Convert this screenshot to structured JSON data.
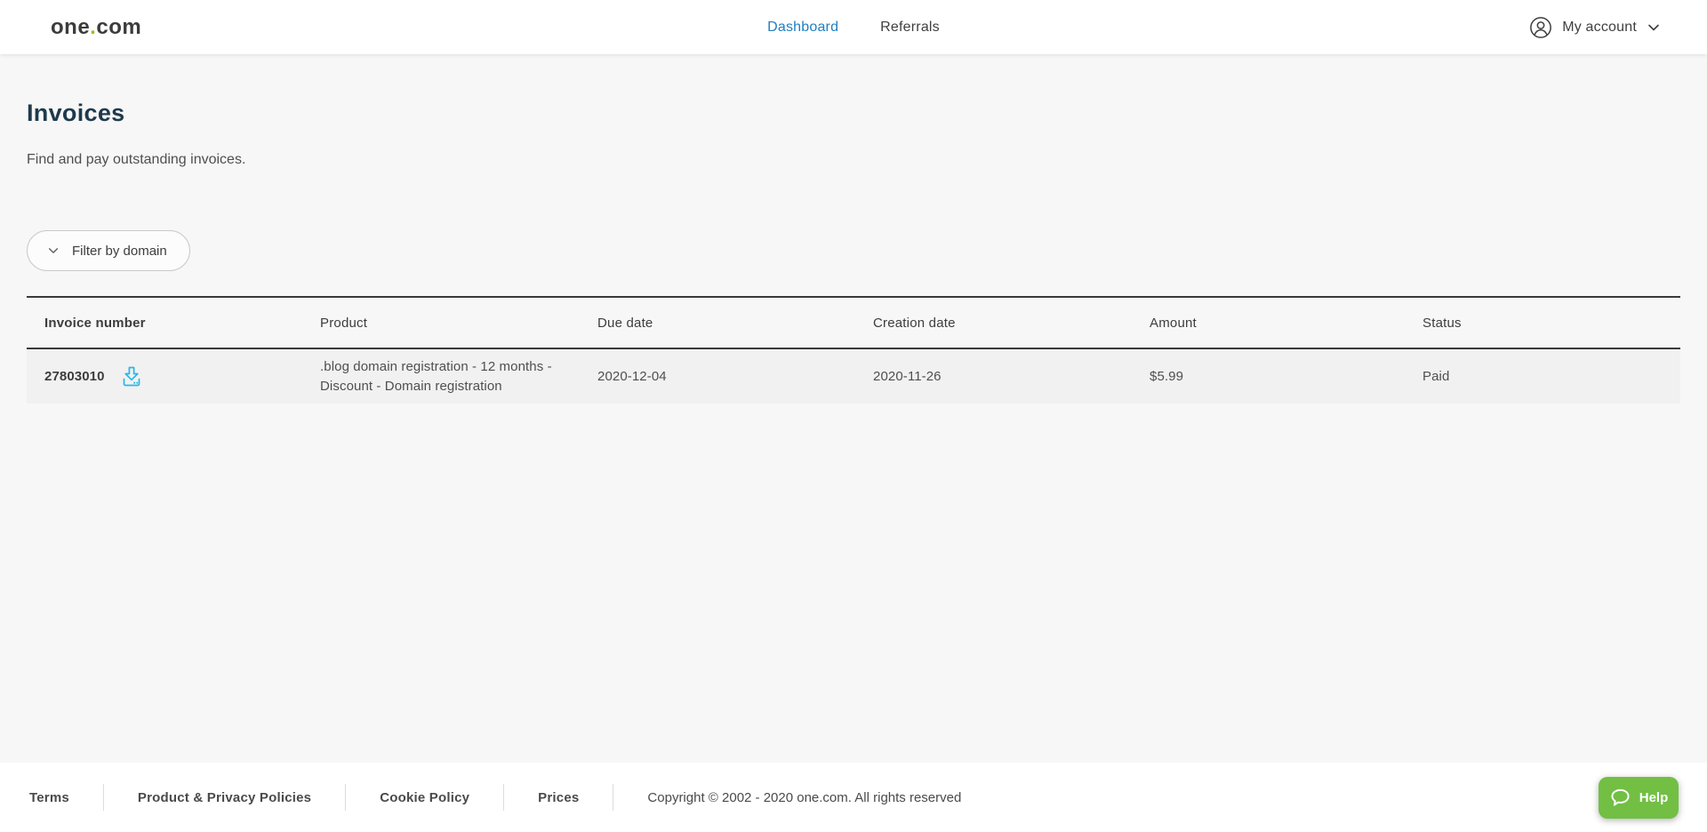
{
  "header": {
    "logo": {
      "part1": "one",
      "dot": ".",
      "part2": "com"
    },
    "nav": [
      {
        "label": "Dashboard",
        "active": true
      },
      {
        "label": "Referrals",
        "active": false
      }
    ],
    "account": {
      "label": "My account"
    }
  },
  "page": {
    "title": "Invoices",
    "subtitle": "Find and pay outstanding invoices.",
    "filter_button_label": "Filter by domain"
  },
  "invoices_table": {
    "columns": [
      "Invoice number",
      "Product",
      "Due date",
      "Creation date",
      "Amount",
      "Status"
    ],
    "rows": [
      {
        "invoice_number": "27803010",
        "product": ".blog domain registration - 12 months - Discount - Domain registration",
        "due_date": "2020-12-04",
        "creation_date": "2020-11-26",
        "amount": "$5.99",
        "status": "Paid"
      }
    ]
  },
  "footer": {
    "links": [
      "Terms",
      "Product & Privacy Policies",
      "Cookie Policy",
      "Prices"
    ],
    "copyright": "Copyright © 2002 - 2020 one.com. All rights reserved",
    "help_label": "Help"
  },
  "icons": {
    "user-icon": "person in circle",
    "chevron-down-icon": "chevron down",
    "download-icon": "download invoice",
    "chat-bubble-icon": "help chat bubble"
  },
  "colors": {
    "nav_active_blue": "#1f7ec0",
    "brand_green": "#9ac31c",
    "help_green": "#72bf44",
    "download_cyan": "#29b7e8",
    "heading_navy": "#1e3a4c",
    "table_border": "#3a3a3a",
    "row_bg": "#f1f1f1",
    "page_bg": "#f7f7f7"
  }
}
